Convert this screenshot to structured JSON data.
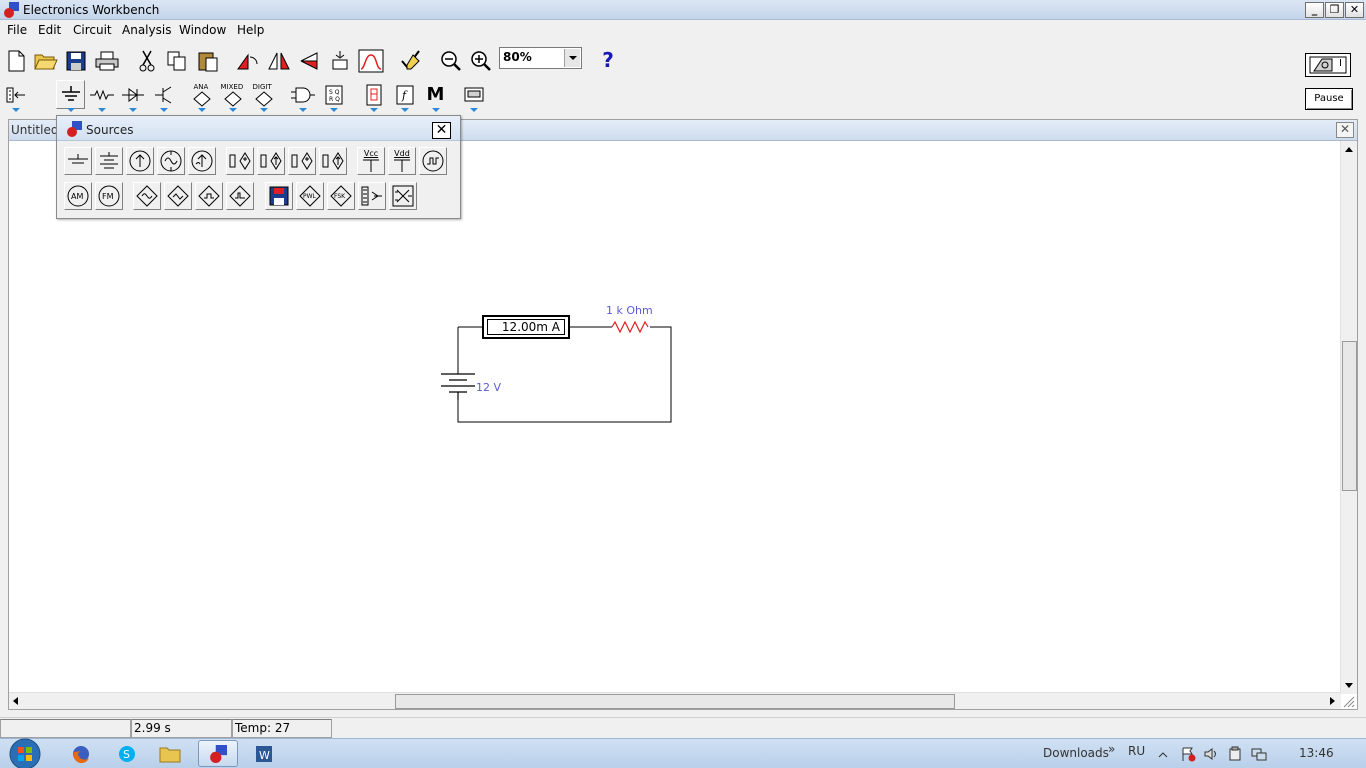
{
  "window": {
    "title": "Electronics Workbench",
    "min": "_",
    "max": "❐",
    "close": "✕"
  },
  "menu": [
    "File",
    "Edit",
    "Circuit",
    "Analysis",
    "Window",
    "Help"
  ],
  "toolbar": {
    "zoom_value": "80%",
    "help_label": "?",
    "bins": {
      "analog": "ANA",
      "mixed": "MIXED",
      "digital": "DIGIT",
      "misc": "M"
    },
    "pause_label": "Pause",
    "power_label": "I"
  },
  "circuit_window": {
    "title": "Untitled",
    "close": "✕"
  },
  "sources_palette": {
    "title": "Sources",
    "close": "✕",
    "vcc_label": "Vcc",
    "vdd_label": "Vdd",
    "am_label": "AM",
    "fm_label": "FM",
    "pwl_label": "PWL",
    "fsk_label": "FSK"
  },
  "circuit": {
    "ammeter_reading": "12.00m A",
    "resistor_label": "1 k Ohm",
    "battery_label": "12 V"
  },
  "status": {
    "time": "2.99 s",
    "temp": "Temp:  27"
  },
  "taskbar": {
    "downloads": "Downloads",
    "chevron": "»",
    "lang": "RU",
    "clock": "13:46"
  },
  "colors": {
    "title_bar": "#c3d4ea",
    "component_label": "#5b5bd6",
    "toolbar_arrow": "#2d89d8",
    "help": "#1818b4"
  }
}
